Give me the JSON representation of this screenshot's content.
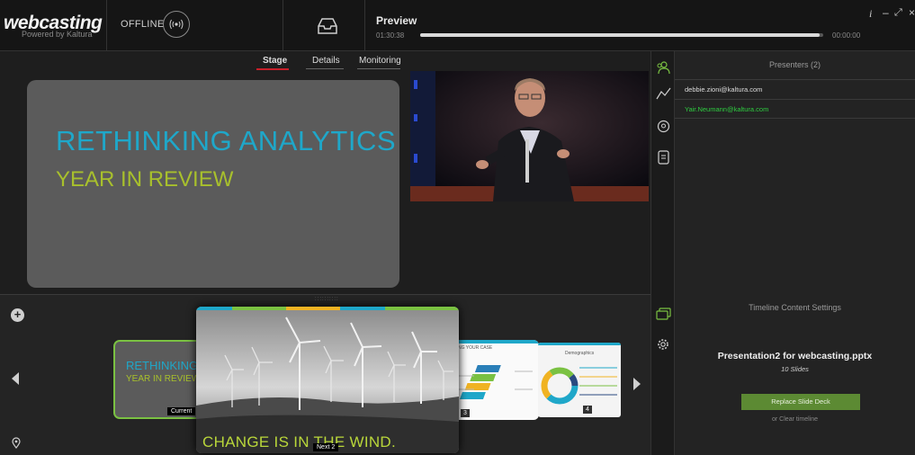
{
  "header": {
    "logo": "webcasting",
    "logo_sub": "Powered by Kaltura",
    "status": "OFFLINE",
    "preview_title": "Preview",
    "time_start": "01:30:38",
    "time_end": "00:00:00",
    "progress": 0.99,
    "info": "i",
    "minimize": "–",
    "maximize": "⤢",
    "close": "×"
  },
  "tabs": [
    "Stage",
    "Details",
    "Monitoring"
  ],
  "stage": {
    "slide_title": "RETHINKING ANALYTICS",
    "slide_subtitle": "YEAR IN REVIEW"
  },
  "presenters": {
    "title": "Presenters (2)",
    "list": [
      "debbie.zioni@kaltura.com",
      "Yair.Neumann@kaltura.com"
    ]
  },
  "timeline": {
    "current": {
      "title": "RETHINKING",
      "subtitle": "YEAR IN REVIEW",
      "label": "Current"
    },
    "next": {
      "caption": "CHANGE IS IN THE WIND.",
      "label": "Next 2"
    },
    "slide3": {
      "label": "3",
      "heading": "NG YOUR CASE"
    },
    "slide4": {
      "label": "4",
      "heading": "Demographics"
    }
  },
  "settings": {
    "title": "Timeline Content Settings",
    "presentation": "Presentation2 for webcasting.pptx",
    "slide_count": "10 Slides",
    "replace_button": "Replace Slide Deck",
    "clear_link": "or Clear timeline"
  },
  "colors": {
    "accent_green": "#2ecc40",
    "slide_blue": "#1fa7c9",
    "slide_green": "#a8c02c",
    "tab_red": "#c8202a"
  }
}
